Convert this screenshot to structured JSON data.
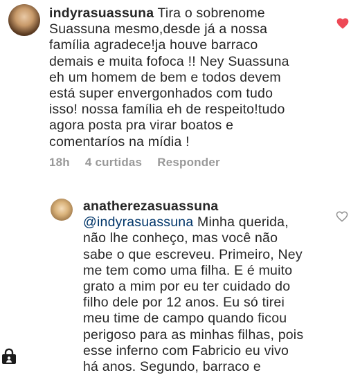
{
  "comments": [
    {
      "username": "indyrasuassuna",
      "text": " Tira o sobrenome\nSuassuna mesmo,desde já a nossa\nfamília agradece!ja houve barraco\ndemais e muita fofoca !! Ney Suassuna\neh um homem de bem e todos devem\nestá super envergonhados com tudo\nisso! nossa família eh de respeito!tudo\nagora posta pra virar boatos e\ncomentaríos na mídia !",
      "time": "18h",
      "likes": "4 curtidas",
      "reply_label": "Responder",
      "liked": true,
      "like_color": "#ed4956"
    },
    {
      "username": "anatherezasuassuna",
      "mention": "@indyrasuassuna",
      "text": " Minha querida,\nnão lhe conheço, mas  você não\nsabe o que escreveu. Primeiro, Ney\nme tem como uma filha. E é muito\ngrato a mim por eu ter cuidado do\nfilho dele por 12 anos. Eu só tirei\nmeu time de campo quando ficou\nperigoso para as minhas filhas, pois\nesse inferno com Fabricio eu vivo\nhá anos. Segundo, barraco e",
      "liked": false
    }
  ],
  "icons": {
    "heart_filled": "heart-icon",
    "heart_outline": "heart-outline-icon",
    "corner": "lock-icon"
  }
}
